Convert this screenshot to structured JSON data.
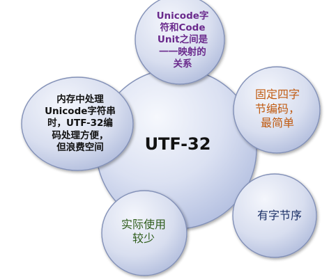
{
  "center": {
    "text": "UTF-32"
  },
  "satellites": {
    "top": {
      "text": "Unicode字\n符和Code\nUnit之间是\n一一映射的\n关系"
    },
    "left": {
      "text": "内存中处理\nUnicode字符串\n时，UTF-32编\n码处理方便，\n但浪费空间"
    },
    "right_top": {
      "text": "固定四字\n节编码，\n最简单"
    },
    "right_bottom": {
      "text": "有字节序"
    },
    "bottom_left": {
      "text": "实际使用\n较少"
    }
  },
  "colors": {
    "center_text": "#111111",
    "top_text": "#6a2a8c",
    "left_text": "#111111",
    "right_top_text": "#c05a10",
    "right_bottom_text": "#1a2f66",
    "bottom_left_text": "#2e5c1a",
    "bubble_fill_light": "#eef1fa",
    "bubble_fill_dark": "#b9c4e3",
    "bubble_stroke": "#7f8db3"
  }
}
